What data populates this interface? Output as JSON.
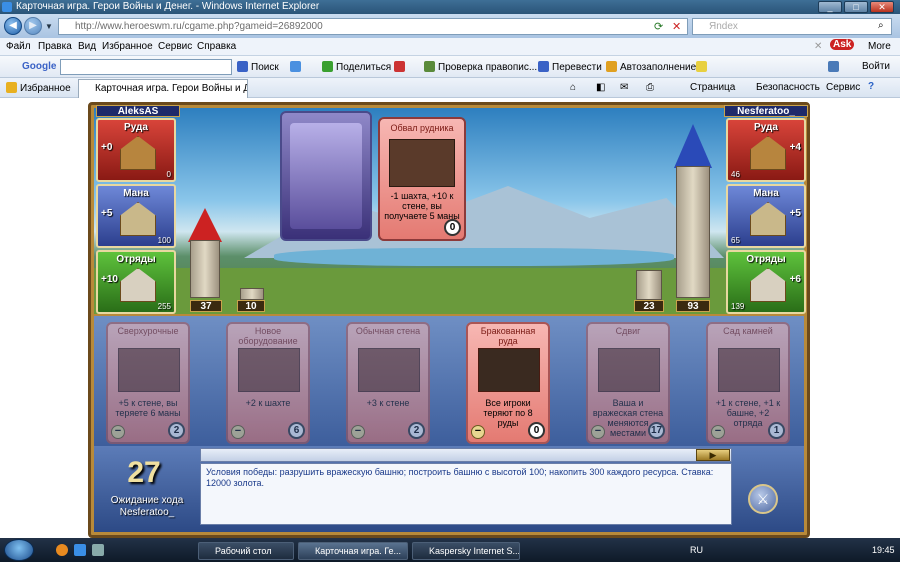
{
  "window": {
    "title": "Карточная игра. Герои Войны и Денег. - Windows Internet Explorer"
  },
  "address": {
    "url": "http://www.heroeswm.ru/cgame.php?gameid=26892000",
    "search_placeholder": "Яndex"
  },
  "menu": [
    "Файл",
    "Правка",
    "Вид",
    "Избранное",
    "Сервис",
    "Справка"
  ],
  "google_toolbar": {
    "brand": "Google",
    "search_label": "Поиск",
    "share": "Поделиться",
    "spell": "Проверка правопис...",
    "translate": "Перевести",
    "autofill": "Автозаполнение",
    "ask": "Ask",
    "more": "More",
    "signin": "Войти"
  },
  "favorites_bar": {
    "favorites": "Избранное",
    "tab_title": "Карточная игра. Герои Войны и Денег.",
    "page": "Страница",
    "security": "Безопасность",
    "service": "Сервис"
  },
  "game": {
    "left_player": {
      "name": "AleksAS",
      "resources": [
        {
          "label": "Руда",
          "income": "+0",
          "amount": "0"
        },
        {
          "label": "Мана",
          "income": "+5",
          "amount": "100"
        },
        {
          "label": "Отряды",
          "income": "+10",
          "amount": "255"
        }
      ],
      "tower": "37",
      "wall": "10"
    },
    "right_player": {
      "name": "Nesferatoo_",
      "resources": [
        {
          "label": "Руда",
          "income": "+4",
          "amount": "46"
        },
        {
          "label": "Мана",
          "income": "+5",
          "amount": "65"
        },
        {
          "label": "Отряды",
          "income": "+6",
          "amount": "139"
        }
      ],
      "wall": "23",
      "tower": "93"
    },
    "played_card": {
      "title": "Обвал рудника",
      "desc": "-1 шахта, +10 к стене, вы получаете 5 маны",
      "cost": "0"
    },
    "hand": [
      {
        "title": "Сверхурочные",
        "desc": "+5 к стене, вы теряете 6 маны",
        "cost": "2"
      },
      {
        "title": "Новое оборудование",
        "desc": "+2 к шахте",
        "cost": "6"
      },
      {
        "title": "Обычная стена",
        "desc": "+3 к стене",
        "cost": "2"
      },
      {
        "title": "Бракованная руда",
        "desc": "Все игроки теряют по 8 руды",
        "cost": "0"
      },
      {
        "title": "Сдвиг",
        "desc": "Ваша и вражеская стена меняются местами",
        "cost": "17"
      },
      {
        "title": "Сад камней",
        "desc": "+1 к стене, +1 к башне, +2 отряда",
        "cost": "1"
      }
    ],
    "turn": {
      "number": "27",
      "label": "Ожидание хода",
      "player": "Nesferatoo_"
    },
    "chat_log": "Условия победы: разрушить вражескую башню; построить башню с высотой 100; накопить 300 каждого ресурса. Ставка: 12000 золота."
  },
  "taskbar": {
    "desktop": "Рабочий стол",
    "ie_task": "Карточная игра. Ге...",
    "kaspersky_task": "Kaspersky Internet S...",
    "lang": "RU",
    "clock": "19:45"
  },
  "colors": {
    "title_bar": "#2a5478",
    "game_frame": "#b88a3a",
    "card_red": "#e47a72",
    "panel_blue": "#3d5e9c",
    "taskbar": "#0e1a28"
  }
}
